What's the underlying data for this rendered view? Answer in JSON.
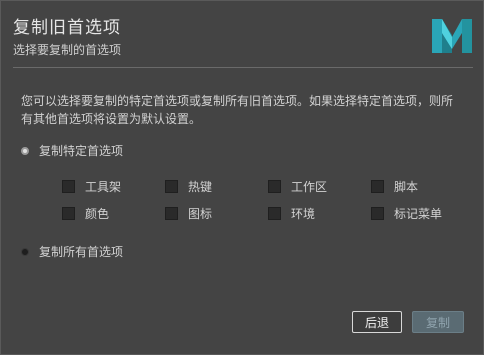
{
  "header": {
    "title": "复制旧首选项",
    "subtitle": "选择要复制的首选项"
  },
  "description": "您可以选择要复制的特定首选项或复制所有旧首选项。如果选择特定首选项，则所有其他首选项将设置为默认设置。",
  "options": {
    "specific": {
      "label": "复制特定首选项",
      "selected": true
    },
    "all": {
      "label": "复制所有首选项",
      "selected": false
    }
  },
  "checkboxes": [
    {
      "label": "工具架",
      "checked": false
    },
    {
      "label": "热键",
      "checked": false
    },
    {
      "label": "工作区",
      "checked": false
    },
    {
      "label": "脚本",
      "checked": false
    },
    {
      "label": "颜色",
      "checked": false
    },
    {
      "label": "图标",
      "checked": false
    },
    {
      "label": "环境",
      "checked": false
    },
    {
      "label": "标记菜单",
      "checked": false
    }
  ],
  "buttons": {
    "back": "后退",
    "copy": "复制"
  },
  "colors": {
    "dialog_bg": "#444444",
    "accent": "#2aa6b8",
    "copy_disabled_bg": "#5a6b73"
  },
  "icons": {
    "logo": "maya-m-logo"
  }
}
